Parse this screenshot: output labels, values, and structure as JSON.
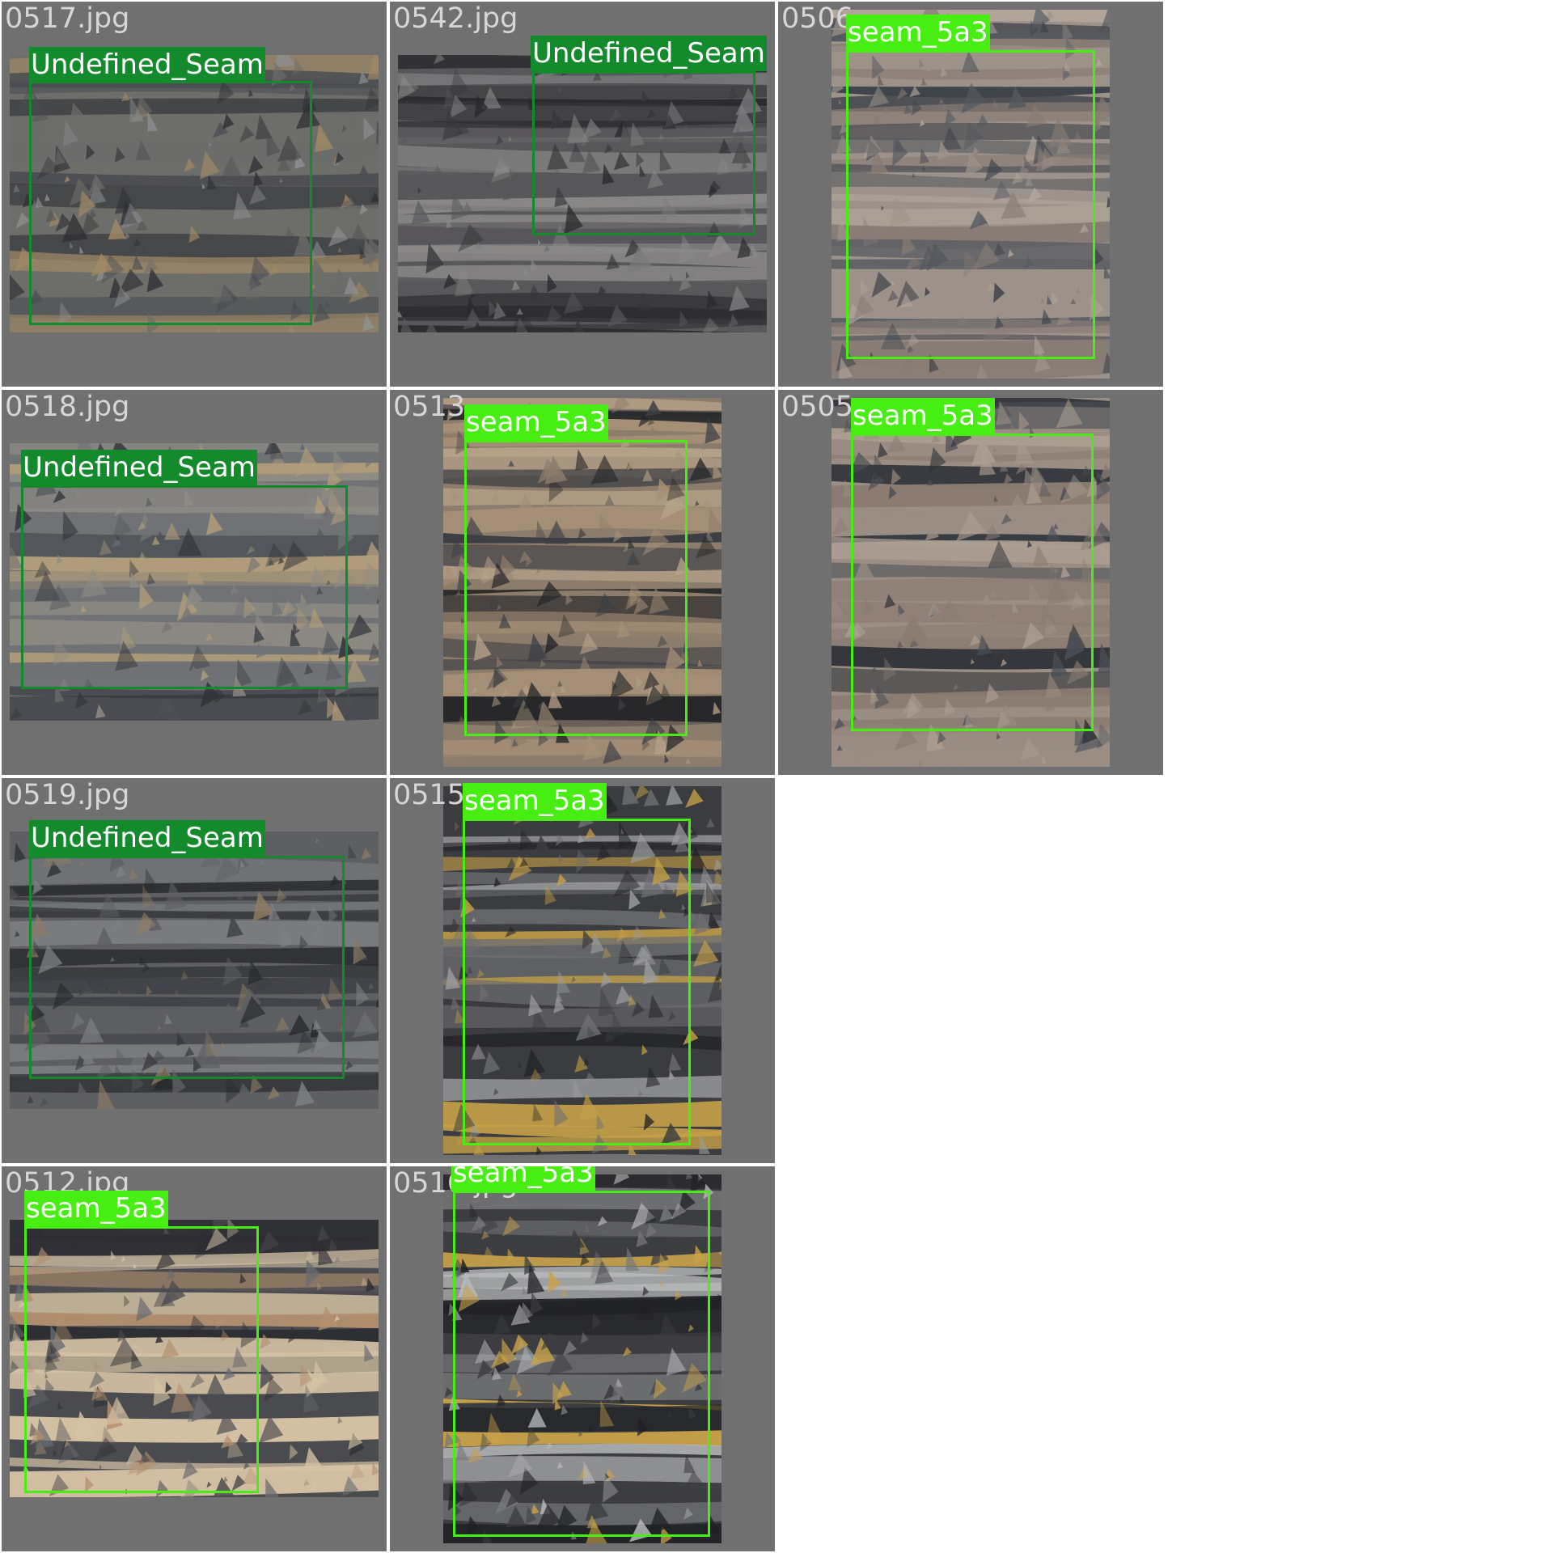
{
  "tiles": [
    {
      "filename": "0517.jpg",
      "label": "Undefined_Seam",
      "class": "undef",
      "palette": [
        "#6d6d6a",
        "#4b4d52",
        "#a18a66",
        "#2e3034",
        "#8d8f91"
      ]
    },
    {
      "filename": "0542.jpg",
      "label": "Undefined_Seam",
      "class": "undef",
      "palette": [
        "#58575a",
        "#37373b",
        "#7b7a7b",
        "#2a2a2e",
        "#8e8c8b"
      ]
    },
    {
      "filename": "0506",
      "label": "seam_5a3",
      "class": "seam",
      "palette": [
        "#9d9289",
        "#877c74",
        "#54585f",
        "#b2a79b",
        "#3f434b"
      ]
    },
    {
      "filename": "0518.jpg",
      "label": "Undefined_Seam",
      "class": "undef",
      "palette": [
        "#707275",
        "#4d5257",
        "#b19d7a",
        "#2f3238",
        "#8f8c84"
      ]
    },
    {
      "filename": "0513",
      "label": "seam_5a3",
      "class": "seam",
      "palette": [
        "#8c7c6b",
        "#3b3e44",
        "#a68f77",
        "#262729",
        "#b7a28a"
      ]
    },
    {
      "filename": "0505",
      "label": "seam_5a3",
      "class": "seam",
      "palette": [
        "#9a8d83",
        "#8a7b71",
        "#4b4f57",
        "#ad9f92",
        "#2f3339"
      ]
    },
    {
      "filename": "0519.jpg",
      "label": "Undefined_Seam",
      "class": "undef",
      "palette": [
        "#5e5f62",
        "#3c3f45",
        "#8f7c62",
        "#27292d",
        "#7d7f83"
      ]
    },
    {
      "filename": "0515",
      "label": "seam_5a3",
      "class": "seam",
      "palette": [
        "#3b3c40",
        "#1f2023",
        "#6e6f72",
        "#c5a047",
        "#9b9c9f"
      ]
    },
    {
      "filename": "0512.jpg",
      "label": "seam_5a3",
      "class": "seam",
      "palette": [
        "#4a4b4f",
        "#2d2e33",
        "#b39070",
        "#6a6b70",
        "#d6c3a5"
      ]
    },
    {
      "filename": "0516.jpg",
      "label": "seam_5a3",
      "class": "seam",
      "palette": [
        "#3c3d41",
        "#202125",
        "#767779",
        "#c9a24a",
        "#b9babc"
      ]
    }
  ]
}
